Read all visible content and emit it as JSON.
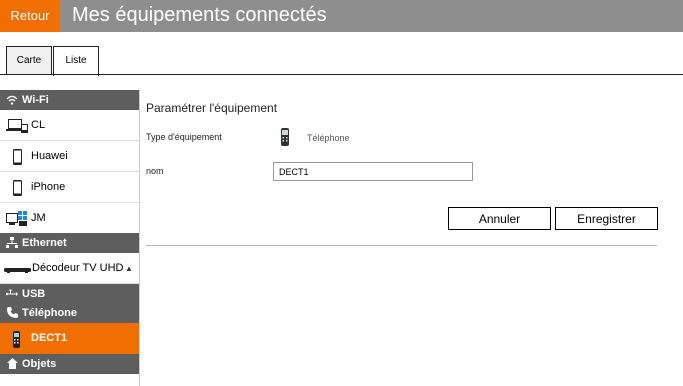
{
  "header": {
    "back_label": "Retour",
    "title": "Mes équipements connectés"
  },
  "tabs": [
    {
      "label": "Carte"
    },
    {
      "label": "Liste",
      "active": true
    }
  ],
  "sidebar": {
    "sections": [
      {
        "label": "Wi-Fi",
        "icon": "wifi-icon"
      },
      {
        "label": "Ethernet",
        "icon": "ethernet-icon"
      },
      {
        "label": "USB",
        "icon": "usb-icon"
      },
      {
        "label": "Téléphone",
        "icon": "phone-icon"
      },
      {
        "label": "Objets",
        "icon": "home-icon"
      }
    ],
    "items": [
      {
        "label": "CL",
        "icon": "laptop-icon"
      },
      {
        "label": "Huawei",
        "icon": "smartphone-icon"
      },
      {
        "label": "iPhone",
        "icon": "smartphone-icon"
      },
      {
        "label": "JM",
        "icon": "windows-pc-icon"
      },
      {
        "label": "Décodeur TV UHD",
        "icon": "tv-decoder-icon"
      },
      {
        "label": "DECT1",
        "icon": "dect-phone-icon",
        "active": true
      }
    ]
  },
  "main": {
    "section_title": "Paramétrer l'équipement",
    "type_label": "Type d'équipement",
    "type_value": "Téléphone",
    "name_label": "nom",
    "name_value": "DECT1",
    "cancel_label": "Annuler",
    "save_label": "Enregistrer"
  },
  "colors": {
    "accent": "#f16e00",
    "header_bg": "#8e8e8e",
    "section_bg": "#5e5e5e"
  }
}
